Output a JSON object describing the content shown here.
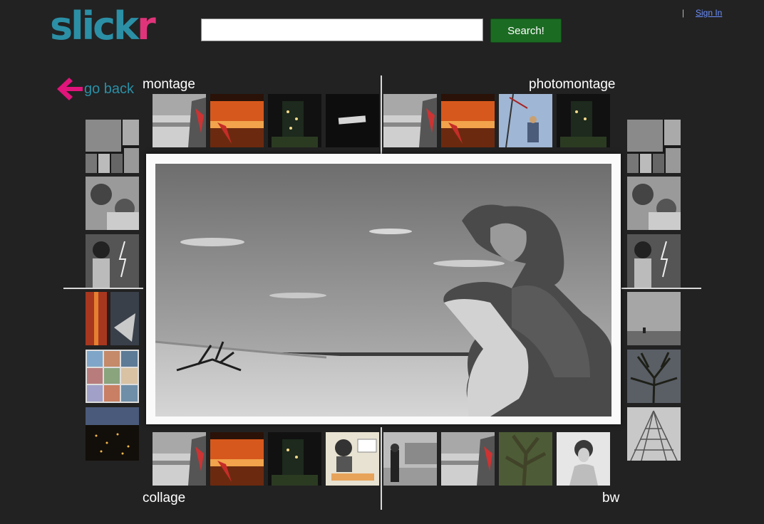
{
  "header": {
    "logo_part1": "slick",
    "logo_part2": "r",
    "search_placeholder": "",
    "search_value": "",
    "search_button": "Search!",
    "separator": "|",
    "sign_in": "Sign In"
  },
  "nav": {
    "go_back": "go back"
  },
  "labels": {
    "top_left": "montage",
    "top_right": "photomontage",
    "bottom_left": "collage",
    "bottom_right": "bw"
  },
  "colors": {
    "background": "#222222",
    "brand_teal": "#2b8fa6",
    "brand_pink": "#e0347a",
    "search_green": "#1c6b23",
    "link_blue": "#6b8fff"
  },
  "icons": [
    "left-arrow-icon"
  ]
}
